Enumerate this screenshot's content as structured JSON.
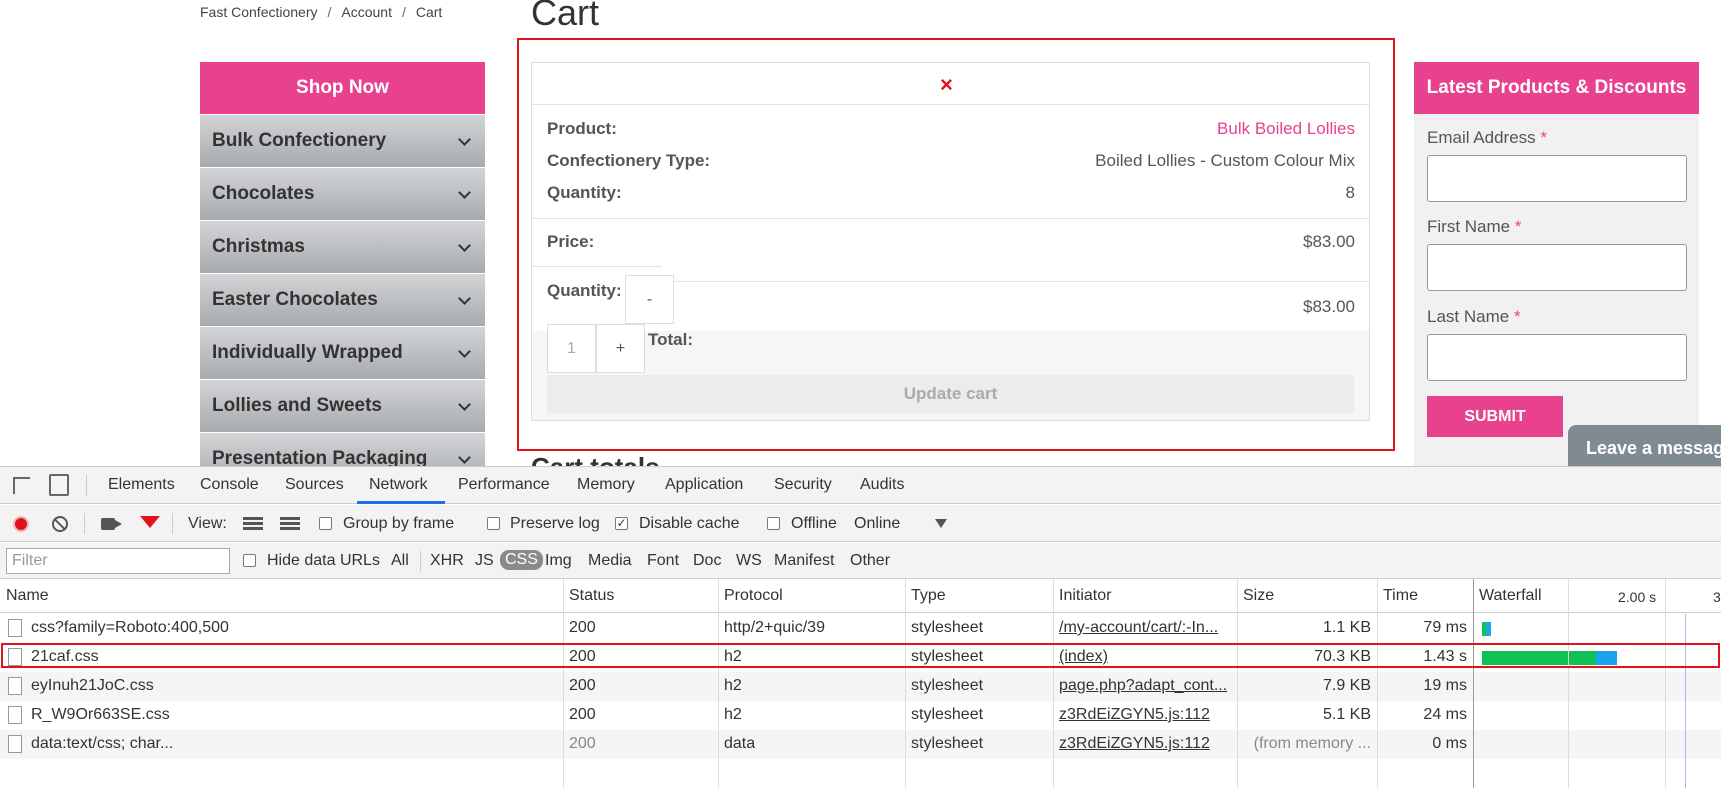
{
  "breadcrumb": [
    "Fast Confectionery",
    "Account",
    "Cart"
  ],
  "breadcrumb_sep": "/",
  "page_title": "Cart",
  "sidebar": {
    "header": "Shop Now",
    "categories": [
      "Bulk Confectionery",
      "Chocolates",
      "Christmas",
      "Easter Chocolates",
      "Individually Wrapped",
      "Lollies and Sweets",
      "Presentation Packaging"
    ]
  },
  "cart": {
    "remove_symbol": "×",
    "product_label": "Product:",
    "product_value": "Bulk Boiled Lollies",
    "type_label": "Confectionery Type:",
    "type_value": "Boiled Lollies - Custom Colour Mix",
    "quantity_label": "Quantity:",
    "quantity_value": "8",
    "price_label": "Price:",
    "price_value": "$83.00",
    "qty_label": "Quantity:",
    "qty_minus": "-",
    "qty_input": "1",
    "qty_plus": "+",
    "subtotal_value": "$83.00",
    "total_label": "Total:",
    "update_button": "Update cart",
    "next_heading": "Cart totals"
  },
  "newsletter": {
    "header": "Latest Products & Discounts",
    "email_label": "Email Address",
    "first_label": "First Name",
    "last_label": "Last Name",
    "required_mark": "*",
    "submit": "SUBMIT"
  },
  "chat": {
    "label": "Leave a message"
  },
  "devtools": {
    "tabs": [
      "Elements",
      "Console",
      "Sources",
      "Network",
      "Performance",
      "Memory",
      "Application",
      "Security",
      "Audits"
    ],
    "active_tab": "Network",
    "toolbar": {
      "view_label": "View:",
      "group_by_frame": "Group by frame",
      "preserve_log": "Preserve log",
      "disable_cache": "Disable cache",
      "disable_cache_checked": "✓",
      "offline": "Offline",
      "throttle": "Online"
    },
    "filter_placeholder": "Filter",
    "hide_data_urls": "Hide data URLs",
    "type_filters": [
      "All",
      "XHR",
      "JS",
      "CSS",
      "Img",
      "Media",
      "Font",
      "Doc",
      "WS",
      "Manifest",
      "Other"
    ],
    "active_type": "CSS",
    "columns": [
      "Name",
      "Status",
      "Protocol",
      "Type",
      "Initiator",
      "Size",
      "Time",
      "Waterfall"
    ],
    "waterfall_tick_1": "2.00 s",
    "waterfall_tick_2": "3",
    "rows": [
      {
        "name": "css?family=Roboto:400,500",
        "status": "200",
        "protocol": "http/2+quic/39",
        "type": "stylesheet",
        "initiator": "/my-account/cart/:-In...",
        "size": "1.1 KB",
        "time": "79 ms"
      },
      {
        "name": "21caf.css",
        "status": "200",
        "protocol": "h2",
        "type": "stylesheet",
        "initiator": "(index)",
        "size": "70.3 KB",
        "time": "1.43 s"
      },
      {
        "name": "eyInuh21JoC.css",
        "status": "200",
        "protocol": "h2",
        "type": "stylesheet",
        "initiator": "page.php?adapt_cont...",
        "size": "7.9 KB",
        "time": "19 ms"
      },
      {
        "name": "R_W9Or663SE.css",
        "status": "200",
        "protocol": "h2",
        "type": "stylesheet",
        "initiator": "z3RdEiZGYN5.js:112",
        "size": "5.1 KB",
        "time": "24 ms"
      },
      {
        "name": "data:text/css; char...",
        "status": "200",
        "protocol": "data",
        "type": "stylesheet",
        "initiator": "z3RdEiZGYN5.js:112",
        "size": "(from memory ...",
        "time": "0 ms"
      }
    ]
  },
  "colors": {
    "brand_pink": "#e8418e",
    "highlight_red": "#e0121c",
    "wf_green": "#0fc256",
    "wf_blue": "#1aa3ee"
  }
}
